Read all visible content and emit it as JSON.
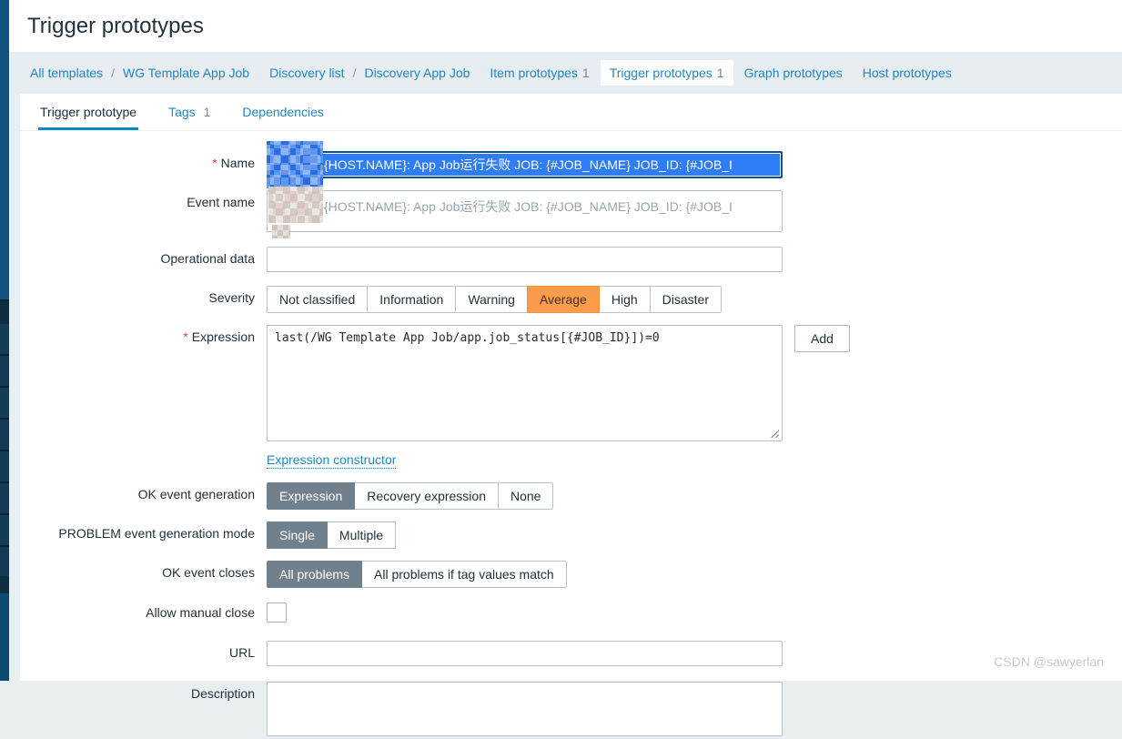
{
  "page": {
    "title": "Trigger prototypes",
    "watermark": "CSDN @sawyerlan"
  },
  "colors": {
    "link_blue": "#2187c5",
    "active_tab_underline": "#0787c8",
    "severity_average_orange": "#f99c4d",
    "segment_selected_gray": "#70818d",
    "selection_blue": "#2e7cf6",
    "sidebar_blue": "#10517f",
    "sidebar_dark_navy": "#0e2d3f"
  },
  "breadcrumb": {
    "items": [
      {
        "label": "All templates"
      },
      {
        "label": "WG Template App Job"
      },
      {
        "label": "Discovery list"
      },
      {
        "label": "Discovery App Job"
      },
      {
        "label": "Item prototypes",
        "count": "1"
      },
      {
        "label": "Trigger prototypes",
        "count": "1"
      },
      {
        "label": "Graph prototypes"
      },
      {
        "label": "Host prototypes"
      }
    ],
    "separator": "/"
  },
  "tabs": {
    "items": [
      {
        "label": "Trigger prototype"
      },
      {
        "label": "Tags",
        "count": "1"
      },
      {
        "label": "Dependencies"
      }
    ]
  },
  "form": {
    "required_marker": "*",
    "name": {
      "label": "Name",
      "value": "{HOST.NAME}: App Job运行失败 JOB: {#JOB_NAME} JOB_ID: {#JOB_I"
    },
    "event_name": {
      "label": "Event name",
      "value": "{HOST.NAME}: App Job运行失败 JOB: {#JOB_NAME} JOB_ID: {#JOB_I"
    },
    "operational_data": {
      "label": "Operational data",
      "value": ""
    },
    "severity": {
      "label": "Severity",
      "options": [
        "Not classified",
        "Information",
        "Warning",
        "Average",
        "High",
        "Disaster"
      ],
      "selected": "Average"
    },
    "expression": {
      "label": "Expression",
      "value": "last(/WG Template App Job/app.job_status[{#JOB_ID}])=0",
      "add_label": "Add",
      "constructor_label": "Expression constructor"
    },
    "ok_event_generation": {
      "label": "OK event generation",
      "options": [
        "Expression",
        "Recovery expression",
        "None"
      ],
      "selected": "Expression"
    },
    "problem_event_generation_mode": {
      "label": "PROBLEM event generation mode",
      "options": [
        "Single",
        "Multiple"
      ],
      "selected": "Single"
    },
    "ok_event_closes": {
      "label": "OK event closes",
      "options": [
        "All problems",
        "All problems if tag values match"
      ],
      "selected": "All problems"
    },
    "allow_manual_close": {
      "label": "Allow manual close",
      "checked": false
    },
    "url": {
      "label": "URL",
      "value": ""
    },
    "description": {
      "label": "Description",
      "value": ""
    }
  }
}
